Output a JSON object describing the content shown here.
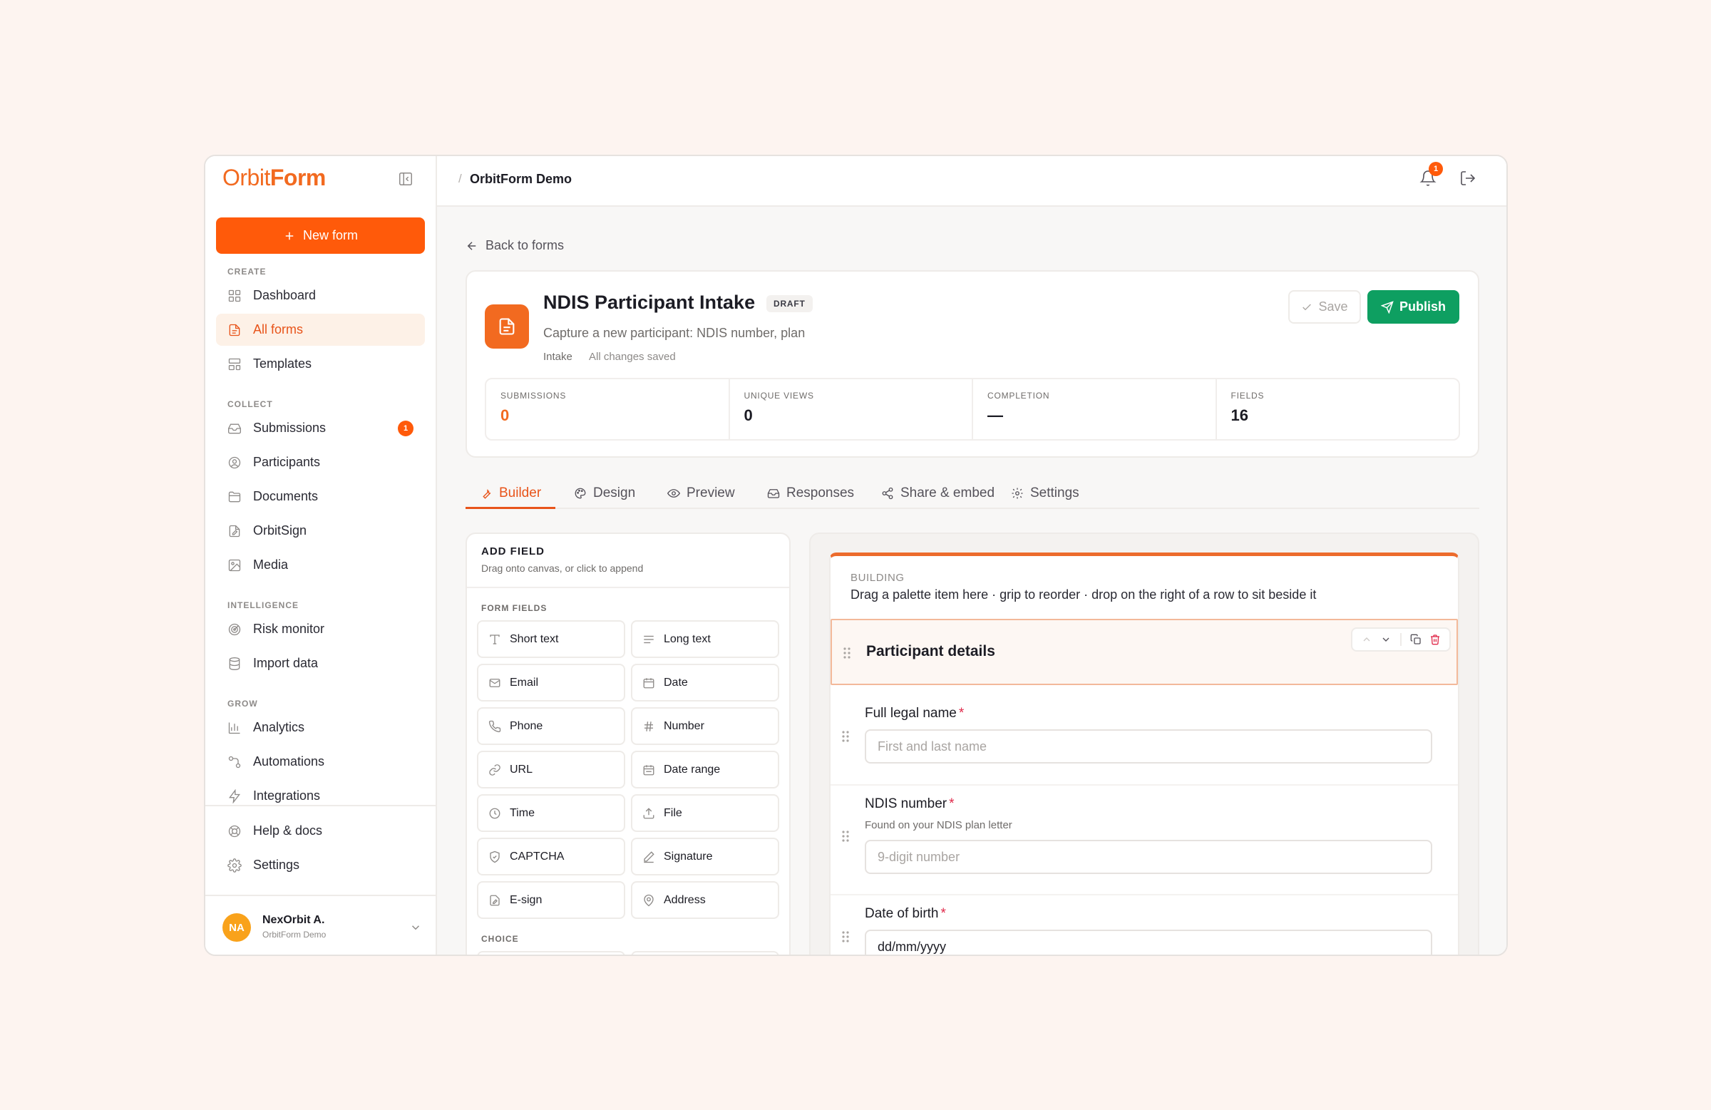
{
  "brand": {
    "part1": "Orbit",
    "part2": "Form"
  },
  "sidebar": {
    "new_form_label": "New form",
    "sections": {
      "create": "CREATE",
      "collect": "COLLECT",
      "intelligence": "INTELLIGENCE",
      "grow": "GROW"
    },
    "items": {
      "dashboard": "Dashboard",
      "all_forms": "All forms",
      "templates": "Templates",
      "submissions": "Submissions",
      "submissions_badge": "1",
      "participants": "Participants",
      "documents": "Documents",
      "orbitsign": "OrbitSign",
      "media": "Media",
      "risk_monitor": "Risk monitor",
      "import_data": "Import data",
      "analytics": "Analytics",
      "automations": "Automations",
      "integrations": "Integrations",
      "help": "Help & docs",
      "settings": "Settings"
    },
    "user": {
      "initials": "NA",
      "name": "NexOrbit A.",
      "org": "OrbitForm Demo"
    }
  },
  "topbar": {
    "separator": "/",
    "crumb": "OrbitForm Demo",
    "notification_count": "1"
  },
  "main": {
    "back_label": "Back to forms",
    "form": {
      "title": "NDIS Participant Intake",
      "status": "DRAFT",
      "description": "Capture a new participant: NDIS number, plan",
      "tag": "Intake",
      "saved_status": "All changes saved",
      "save_label": "Save",
      "publish_label": "Publish"
    },
    "stats": [
      {
        "label": "SUBMISSIONS",
        "value": "0"
      },
      {
        "label": "UNIQUE VIEWS",
        "value": "0"
      },
      {
        "label": "COMPLETION",
        "value": "—"
      },
      {
        "label": "FIELDS",
        "value": "16"
      }
    ],
    "tabs": [
      "Builder",
      "Design",
      "Preview",
      "Responses",
      "Share & embed",
      "Settings"
    ],
    "palette": {
      "title": "ADD FIELD",
      "subtitle": "Drag onto canvas, or click to append",
      "form_fields_label": "FORM FIELDS",
      "choice_label": "CHOICE",
      "fields": [
        "Short text",
        "Long text",
        "Email",
        "Date",
        "Phone",
        "Number",
        "URL",
        "Date range",
        "Time",
        "File",
        "CAPTCHA",
        "Signature",
        "E-sign",
        "Address"
      ]
    },
    "canvas": {
      "kicker": "BUILDING",
      "hint": "Drag a palette item here · grip to reorder · drop on the right of a row to sit beside it",
      "section_title": "Participant details",
      "questions": [
        {
          "label": "Full legal name",
          "required": "*",
          "help": "",
          "placeholder": "First and last name"
        },
        {
          "label": "NDIS number",
          "required": "*",
          "help": "Found on your NDIS plan letter",
          "placeholder": "9-digit number"
        },
        {
          "label": "Date of birth",
          "required": "*",
          "help": "",
          "placeholder": "dd/mm/yyyy"
        }
      ]
    }
  }
}
